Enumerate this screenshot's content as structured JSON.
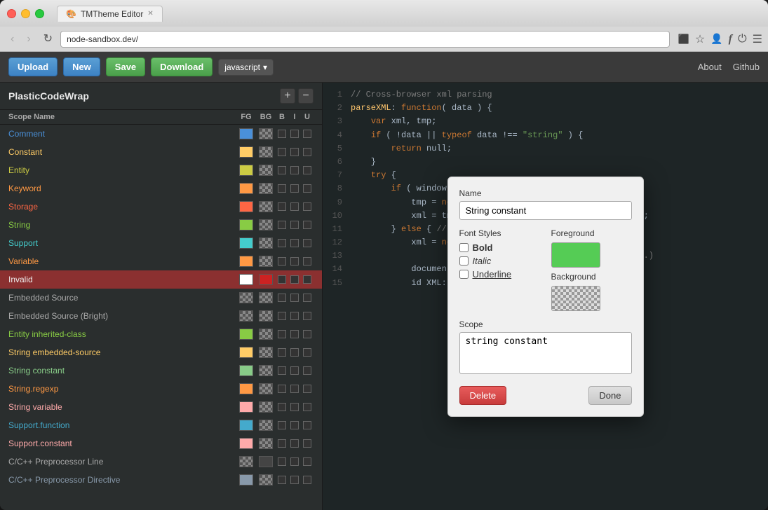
{
  "window": {
    "title": "TMTheme Editor",
    "tab_label": "TMTheme Editor"
  },
  "nav": {
    "address": "node-sandbox.dev/"
  },
  "toolbar": {
    "upload_label": "Upload",
    "new_label": "New",
    "save_label": "Save",
    "download_label": "Download",
    "language": "javascript",
    "about_label": "About",
    "github_label": "Github"
  },
  "theme": {
    "name": "PlasticCodeWrap",
    "columns": {
      "scope": "Scope Name",
      "fg": "FG",
      "bg": "BG",
      "b": "B",
      "i": "I",
      "u": "U"
    },
    "scopes": [
      {
        "label": "Comment",
        "fg_color": "#4a90d9",
        "bg_color": null,
        "color": "#4a90d9",
        "is_color": true
      },
      {
        "label": "Constant",
        "fg_color": "#ffcc66",
        "bg_color": null,
        "color": "#ffcc66",
        "is_color": true
      },
      {
        "label": "Entity",
        "fg_color": "#cccc44",
        "bg_color": null,
        "color": "#cccc44",
        "is_color": true
      },
      {
        "label": "Keyword",
        "fg_color": "#ff9944",
        "bg_color": null,
        "color": "#ff9944",
        "is_color": true
      },
      {
        "label": "Storage",
        "fg_color": "#ff6644",
        "bg_color": null,
        "color": "#ff6644",
        "is_color": true
      },
      {
        "label": "String",
        "fg_color": "#88cc44",
        "bg_color": null,
        "color": "#88cc44",
        "is_color": true
      },
      {
        "label": "Support",
        "fg_color": "#44cccc",
        "bg_color": null,
        "color": "#44cccc",
        "is_color": true
      },
      {
        "label": "Variable",
        "fg_color": "#ff9944",
        "bg_color": null,
        "color": "#ff9944",
        "is_color": true
      },
      {
        "label": "Invalid",
        "fg_color": "#ffffff",
        "bg_color": "#cc2222",
        "color": "#ffffff",
        "is_color": true,
        "selected": true
      },
      {
        "label": "Embedded Source",
        "fg_color": null,
        "bg_color": null
      },
      {
        "label": "Embedded Source (Bright)",
        "fg_color": null,
        "bg_color": null
      },
      {
        "label": "Entity inherited-class",
        "fg_color": "#88cc44",
        "bg_color": null,
        "color": "#88cc44",
        "is_color": true
      },
      {
        "label": "String embedded-source",
        "fg_color": "#ffcc66",
        "bg_color": null,
        "color": "#ffcc66",
        "is_color": true
      },
      {
        "label": "String constant",
        "fg_color": "#88cc88",
        "bg_color": null,
        "color": "#88cc88",
        "is_color": true
      },
      {
        "label": "String.regexp",
        "fg_color": "#ff9944",
        "bg_color": null,
        "color": "#ff9944",
        "is_color": true
      },
      {
        "label": "String variable",
        "fg_color": "#ffaaaa",
        "bg_color": null,
        "color": "#ffaaaa",
        "is_color": true
      },
      {
        "label": "Support.function",
        "fg_color": "#44aacc",
        "bg_color": null,
        "color": "#44aacc",
        "is_color": true
      },
      {
        "label": "Support.constant",
        "fg_color": "#ffaaaa",
        "bg_color": null,
        "color": "#ffaaaa",
        "is_color": true
      },
      {
        "label": "C/C++ Preprocessor Line",
        "fg_color": null,
        "bg_color": "#444444",
        "is_color": false
      },
      {
        "label": "C/C++ Preprocessor Directive",
        "fg_color": "#8899aa",
        "bg_color": null,
        "color": "#8899aa",
        "is_color": true
      }
    ]
  },
  "code": {
    "lines": [
      {
        "num": "1",
        "content": "// Cross-browser xml parsing",
        "type": "comment"
      },
      {
        "num": "2",
        "content": "parseXML: function( data ) {",
        "type": "code"
      },
      {
        "num": "3",
        "content": "    var xml, tmp;",
        "type": "code"
      },
      {
        "num": "4",
        "content": "    if ( !data || typeof data !== \"string\" ) {",
        "type": "code"
      },
      {
        "num": "5",
        "content": "        return null;",
        "type": "code"
      },
      {
        "num": "6",
        "content": "    }",
        "type": "code"
      },
      {
        "num": "7",
        "content": "    try {",
        "type": "code"
      },
      {
        "num": "8",
        "content": "        if ( window.DOMParser ) { // Standard",
        "type": "code"
      },
      {
        "num": "9",
        "content": "            tmp = new DOMParser();",
        "type": "code"
      },
      {
        "num": "10",
        "content": "            xml = tmp.parseFromString( data , \"text/xml\" );",
        "type": "code"
      },
      {
        "num": "11",
        "content": "        } else { // IE",
        "type": "code"
      },
      {
        "num": "12",
        "content": "            xml = new ActiveXObject( \"Microsoft.XMLDOM\" );",
        "type": "code"
      },
      {
        "num": "13",
        "content": "                                                         ).);",
        "type": "code"
      },
      {
        "num": "14",
        "content": "            documentElement || xml.getElementsByTa",
        "type": "code"
      },
      {
        "num": "15",
        "content": "            id XML: \" + data );",
        "type": "code"
      }
    ]
  },
  "modal": {
    "name_label": "Name",
    "name_value": "String constant",
    "font_styles_label": "Font Styles",
    "bold_label": "Bold",
    "italic_label": "Italic",
    "underline_label": "Underline",
    "foreground_label": "Foreground",
    "background_label": "Background",
    "scope_label": "Scope",
    "scope_value": "string constant",
    "delete_label": "Delete",
    "done_label": "Done"
  }
}
